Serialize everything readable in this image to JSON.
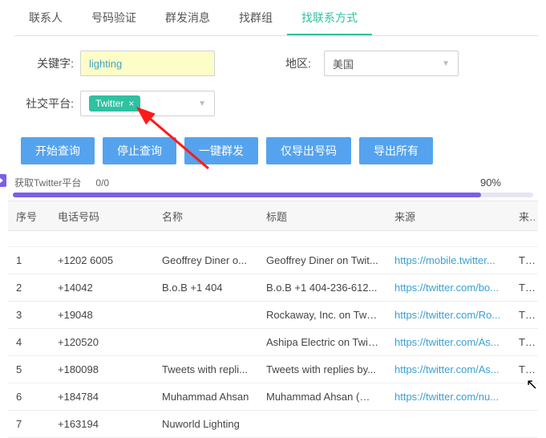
{
  "tabs": [
    {
      "label": "联系人"
    },
    {
      "label": "号码验证"
    },
    {
      "label": "群发消息"
    },
    {
      "label": "找群组"
    },
    {
      "label": "找联系方式",
      "active": true
    }
  ],
  "filters": {
    "keyword_label": "关键字:",
    "keyword_value": "lighting",
    "region_label": "地区:",
    "region_value": "美国",
    "platform_label": "社交平台:",
    "platform_tag": "Twitter",
    "tag_close": "×"
  },
  "buttons": {
    "b1": "开始查询",
    "b2": "停止查询",
    "b3": "一键群发",
    "b4": "仅导出号码",
    "b5": "导出所有"
  },
  "status": {
    "label": "获取Twitter平台",
    "counter": "0/0",
    "percent": "90%"
  },
  "columns": {
    "c0": "序号",
    "c1": "电话号码",
    "c2": "名称",
    "c3": "标题",
    "c4": "来源",
    "c5": "来"
  },
  "rows": [
    {
      "idx": "1",
      "phone": "+1202        6005",
      "name": "Geoffrey Diner o...",
      "title": "Geoffrey Diner on Twit...",
      "src": "https://mobile.twitter...",
      "extra": "Tv"
    },
    {
      "idx": "2",
      "phone": "+14042",
      "name": "B.o.B +1 404",
      "title": "B.o.B +1 404-236-612...",
      "src": "https://twitter.com/bo...",
      "extra": "Tv"
    },
    {
      "idx": "3",
      "phone": "+19048",
      "name": "",
      "title": "Rockaway, Inc. on Twit...",
      "src": "https://twitter.com/Ro...",
      "extra": "Tv"
    },
    {
      "idx": "4",
      "phone": "+120520",
      "name": "",
      "title": "Ashipa Electric on Twit...",
      "src": "https://twitter.com/As...",
      "extra": "Tv"
    },
    {
      "idx": "5",
      "phone": "+180098",
      "name": "Tweets with repli...",
      "title": "Tweets with replies by...",
      "src": "https://twitter.com/As...",
      "extra": "Tv"
    },
    {
      "idx": "6",
      "phone": "+184784",
      "name": "Muhammad Ahsan",
      "title": "Muhammad Ahsan (@...",
      "src": "https://twitter.com/nu...",
      "extra": ""
    },
    {
      "idx": "7",
      "phone": "+163194",
      "name": "Nuworld Lighting",
      "title": "",
      "src": "",
      "extra": ""
    }
  ]
}
